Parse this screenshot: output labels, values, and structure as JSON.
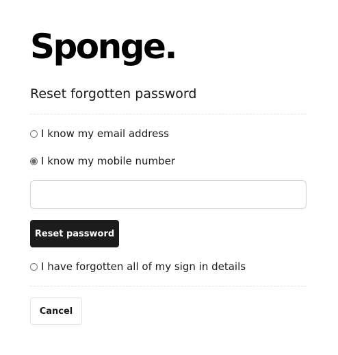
{
  "brand": {
    "logo_text": "Sponge."
  },
  "page": {
    "title": "Reset forgotten password"
  },
  "options": {
    "email_label": "I know my email address",
    "mobile_label": "I know my mobile number",
    "forgot_label": "I have forgotten all of my sign in details",
    "selected": "mobile"
  },
  "mobile_input": {
    "value": "",
    "placeholder": ""
  },
  "actions": {
    "reset_label": "Reset password",
    "cancel_label": "Cancel"
  },
  "colors": {
    "primary_button_bg": "#1c1c1c",
    "primary_button_text": "#ffffff",
    "text": "#1b1b1b",
    "divider": "#e3e3e3"
  }
}
